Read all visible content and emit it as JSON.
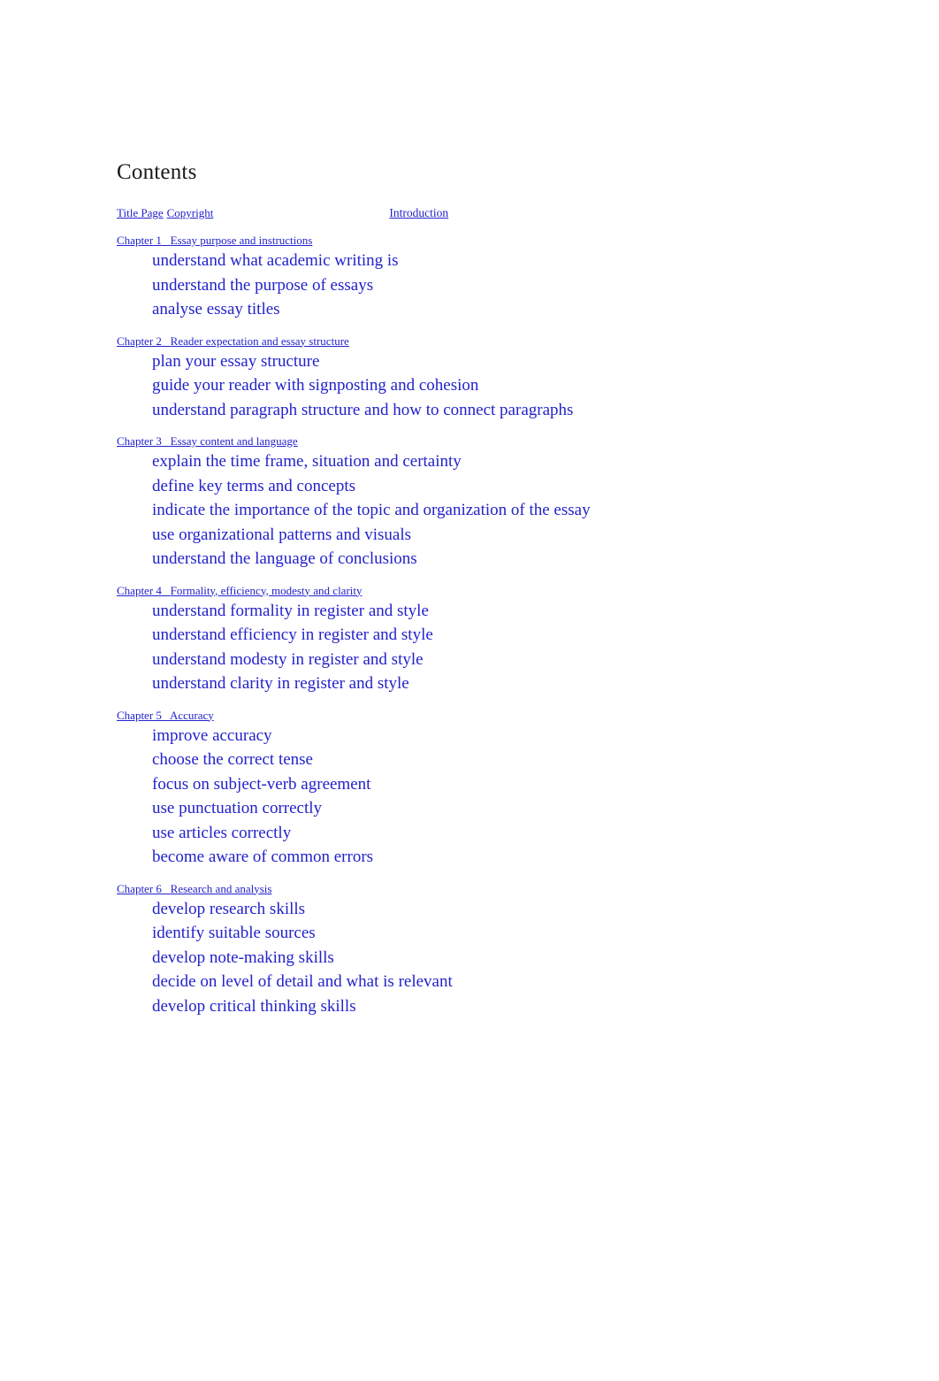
{
  "page": {
    "heading": "Contents",
    "background_color": "#ffffff",
    "link_color": "#2222cc",
    "heading_color": "#1a1a1a"
  },
  "front_matter": [
    {
      "label": "Title Page"
    },
    {
      "label": "Copyright"
    }
  ],
  "introduction": {
    "label": "Introduction"
  },
  "chapters": [
    {
      "number": "Chapter 1",
      "separator": "   ",
      "title": "Essay purpose and instructions",
      "objectives": [
        "understand what academic writing is",
        "understand the purpose of essays",
        "analyse essay titles"
      ]
    },
    {
      "number": "Chapter 2",
      "separator": "   ",
      "title": "Reader expectation and essay structure",
      "objectives": [
        "plan your essay structure",
        "guide your reader with signposting and cohesion",
        "understand paragraph structure and how to connect paragraphs"
      ]
    },
    {
      "number": "Chapter 3",
      "separator": "   ",
      "title": "Essay content and language",
      "objectives": [
        "explain the time frame, situation and certainty",
        "define key terms and concepts",
        "indicate the importance of the topic and organization of the essay",
        "use organizational patterns and visuals",
        "understand the language of conclusions"
      ]
    },
    {
      "number": "Chapter 4",
      "separator": "   ",
      "title": "Formality, efficiency, modesty and clarity",
      "objectives": [
        "understand formality in register and style",
        "understand efficiency in register and style",
        "understand modesty in register and style",
        "understand clarity in register and style"
      ]
    },
    {
      "number": "Chapter 5",
      "separator": "   ",
      "title": "Accuracy",
      "objectives": [
        "improve accuracy",
        "choose the correct tense",
        "focus on subject-verb agreement",
        "use punctuation correctly",
        "use articles correctly",
        "become aware of common errors"
      ]
    },
    {
      "number": "Chapter 6",
      "separator": "   ",
      "title": "Research and analysis",
      "objectives": [
        "develop research skills",
        "identify suitable sources",
        "develop note-making skills",
        "decide on level of detail and what is relevant",
        "develop critical thinking skills"
      ]
    }
  ]
}
